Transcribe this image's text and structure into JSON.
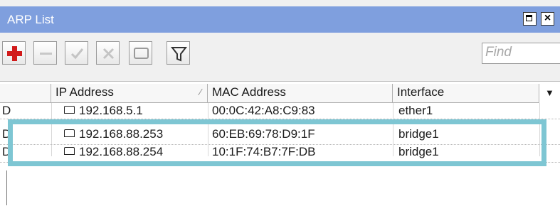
{
  "window": {
    "title": "ARP List",
    "find_placeholder": "Find"
  },
  "toolbar": {
    "buttons": [
      {
        "name": "add",
        "icon": "plus-icon"
      },
      {
        "name": "remove",
        "icon": "minus-icon"
      },
      {
        "name": "enable",
        "icon": "check-icon"
      },
      {
        "name": "disable",
        "icon": "x-icon"
      },
      {
        "name": "comment",
        "icon": "comment-icon"
      },
      {
        "name": "filter",
        "icon": "filter-icon"
      }
    ]
  },
  "table": {
    "columns": {
      "flag": "",
      "ip": "IP Address",
      "mac": "MAC Address",
      "interface": "Interface"
    },
    "rows": [
      {
        "flag": "D",
        "ip": "192.168.5.1",
        "mac": "00:0C:42:A8:C9:83",
        "interface": "ether1"
      },
      {
        "flag": "D",
        "ip": "192.168.88.253",
        "mac": "60:EB:69:78:D9:1F",
        "interface": "bridge1"
      },
      {
        "flag": "D",
        "ip": "192.168.88.254",
        "mac": "10:1F:74:B7:7F:DB",
        "interface": "bridge1"
      }
    ]
  },
  "colors": {
    "titlebar": "#7f9fde",
    "highlight": "#7ec6d3",
    "add_icon": "#d11a1a"
  }
}
